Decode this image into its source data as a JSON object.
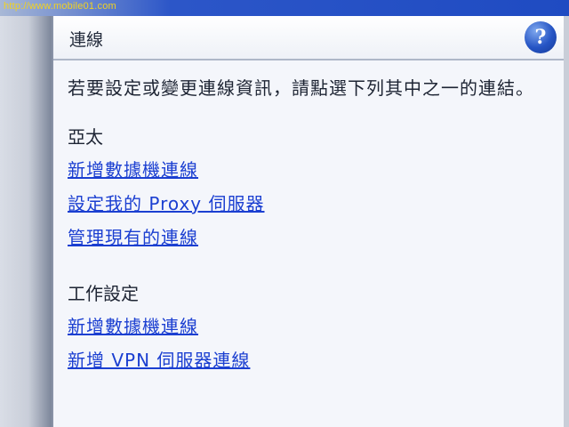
{
  "watermark": "http://www.mobile01.com",
  "header": {
    "title": "連線",
    "help_icon": "help-icon"
  },
  "main": {
    "intro": "若要設定或變更連線資訊，請點選下列其中之一的連結。",
    "groups": [
      {
        "heading": "亞太",
        "links": [
          "新增數據機連線",
          "設定我的 Proxy 伺服器",
          "管理現有的連線"
        ]
      },
      {
        "heading": "工作設定",
        "links": [
          "新增數據機連線",
          "新增 VPN 伺服器連線"
        ]
      }
    ]
  },
  "colors": {
    "link": "#1b3fd1",
    "text": "#1d2433",
    "background": "#f4f6fb",
    "help_icon": "#2554c4"
  }
}
